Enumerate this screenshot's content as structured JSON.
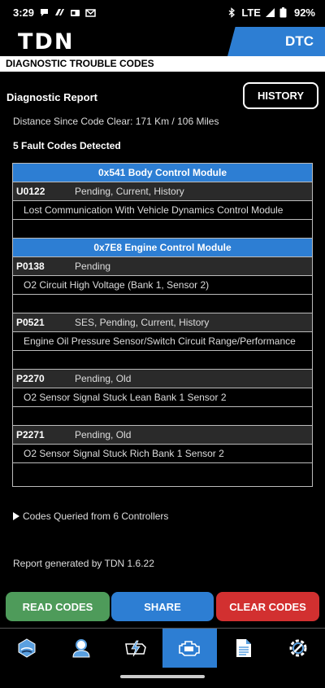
{
  "status": {
    "time": "3:29",
    "network": "LTE",
    "battery": "92%"
  },
  "header": {
    "logo": "TDN",
    "tab": "DTC"
  },
  "subtitle": "DIAGNOSTIC TROUBLE CODES",
  "report": {
    "title": "Diagnostic Report",
    "history_button": "HISTORY",
    "distance": "Distance Since Code Clear: 171 Km / 106 Miles",
    "fault_count": "5 Fault Codes Detected"
  },
  "modules": [
    {
      "name": "0x541 Body Control Module",
      "codes": [
        {
          "code": "U0122",
          "status": "Pending, Current, History",
          "description": "Lost Communication With Vehicle Dynamics Control Module"
        }
      ]
    },
    {
      "name": "0x7E8 Engine Control Module",
      "codes": [
        {
          "code": "P0138",
          "status": "Pending",
          "description": "O2 Circuit High Voltage (Bank 1, Sensor 2)"
        },
        {
          "code": "P0521",
          "status": "SES, Pending, Current, History",
          "description": "Engine Oil Pressure Sensor/Switch Circuit Range/Performance"
        },
        {
          "code": "P2270",
          "status": "Pending, Old",
          "description": "O2 Sensor Signal Stuck Lean Bank 1 Sensor 2"
        },
        {
          "code": "P2271",
          "status": "Pending, Old",
          "description": "O2 Sensor Signal Stuck Rich Bank 1 Sensor 2"
        }
      ]
    }
  ],
  "queried": "Codes Queried from 6 Controllers",
  "generated": "Report generated by TDN 1.6.22",
  "buttons": {
    "read": "READ CODES",
    "share": "SHARE",
    "clear": "CLEAR CODES"
  },
  "nav": [
    {
      "icon": "dashboard-icon",
      "active": false
    },
    {
      "icon": "profile-icon",
      "active": false
    },
    {
      "icon": "battery-charge-icon",
      "active": false
    },
    {
      "icon": "engine-icon",
      "active": true
    },
    {
      "icon": "document-icon",
      "active": false
    },
    {
      "icon": "settings-icon",
      "active": false
    }
  ],
  "colors": {
    "accent": "#2d7ed3",
    "read": "#4e9b5a",
    "clear": "#d23030"
  }
}
